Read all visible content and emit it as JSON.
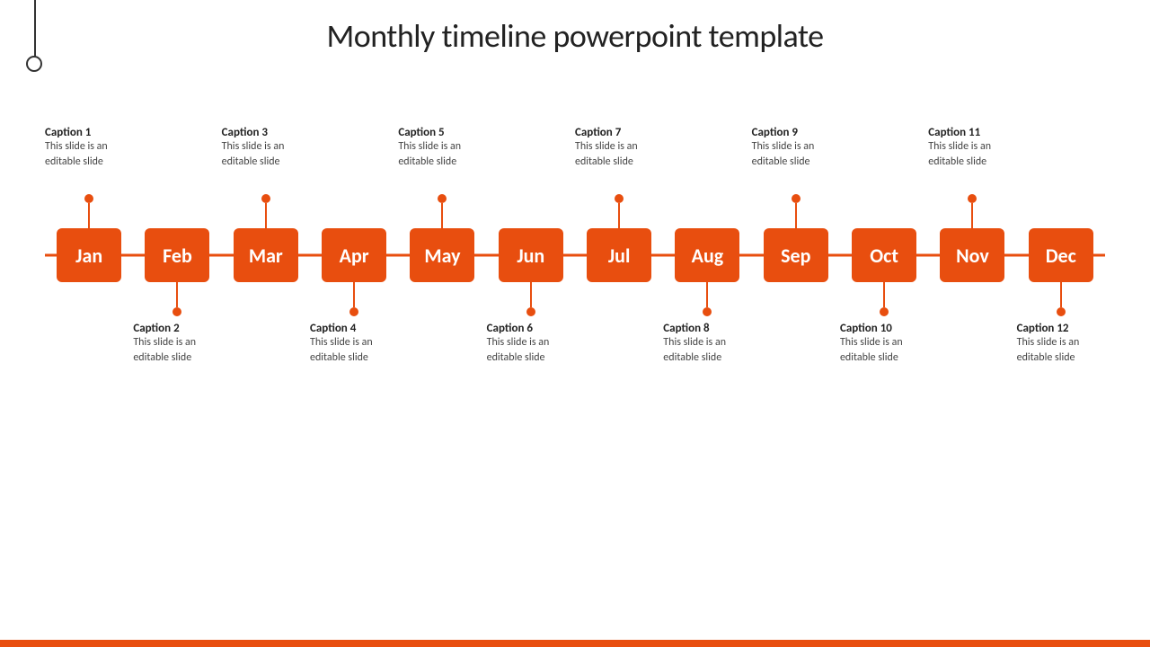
{
  "title": "Monthly timeline powerpoint template",
  "accent_color": "#E84E0F",
  "months": [
    {
      "short": "Jan",
      "caption_pos": "above",
      "caption_num": "Caption 1",
      "caption_text": "This slide is an editable slide"
    },
    {
      "short": "Feb",
      "caption_pos": "below",
      "caption_num": "Caption 2",
      "caption_text": "This slide is an editable slide"
    },
    {
      "short": "Mar",
      "caption_pos": "above",
      "caption_num": "Caption 3",
      "caption_text": "This slide is an editable slide"
    },
    {
      "short": "Apr",
      "caption_pos": "below",
      "caption_num": "Caption 4",
      "caption_text": "This slide is an editable slide"
    },
    {
      "short": "May",
      "caption_pos": "above",
      "caption_num": "Caption 5",
      "caption_text": "This slide is an editable slide"
    },
    {
      "short": "Jun",
      "caption_pos": "below",
      "caption_num": "Caption 6",
      "caption_text": "This slide is an editable slide"
    },
    {
      "short": "Jul",
      "caption_pos": "above",
      "caption_num": "Caption 7",
      "caption_text": "This slide is an editable slide"
    },
    {
      "short": "Aug",
      "caption_pos": "below",
      "caption_num": "Caption 8",
      "caption_text": "This slide is an editable slide"
    },
    {
      "short": "Sep",
      "caption_pos": "above",
      "caption_num": "Caption 9",
      "caption_text": "This slide is an editable slide"
    },
    {
      "short": "Oct",
      "caption_pos": "below",
      "caption_num": "Caption 10",
      "caption_text": "This slide is an editable slide"
    },
    {
      "short": "Nov",
      "caption_pos": "above",
      "caption_num": "Caption 11",
      "caption_text": "This slide is an editable slide"
    },
    {
      "short": "Dec",
      "caption_pos": "below",
      "caption_num": "Caption 12",
      "caption_text": "This slide is an editable slide"
    }
  ]
}
